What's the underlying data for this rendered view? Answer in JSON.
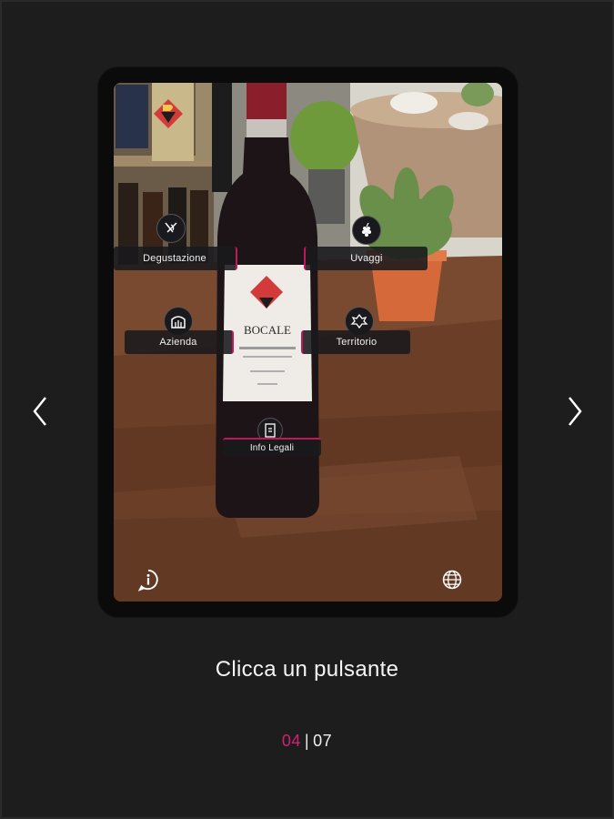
{
  "ar_buttons": {
    "degustazione": "Degustazione",
    "uvaggi": "Uvaggi",
    "azienda": "Azienda",
    "territorio": "Territorio",
    "info_legali": "Info Legali"
  },
  "bottle": {
    "brand": "BOCALE"
  },
  "caption": "Clicca un pulsante",
  "pager": {
    "current": "04",
    "separator": "|",
    "total": "07"
  },
  "colors": {
    "accent": "#d0226f",
    "background": "#1d1d1d"
  },
  "icons": {
    "info": "info-icon",
    "globe": "globe-icon",
    "prev": "chevron-left-icon",
    "next": "chevron-right-icon"
  }
}
